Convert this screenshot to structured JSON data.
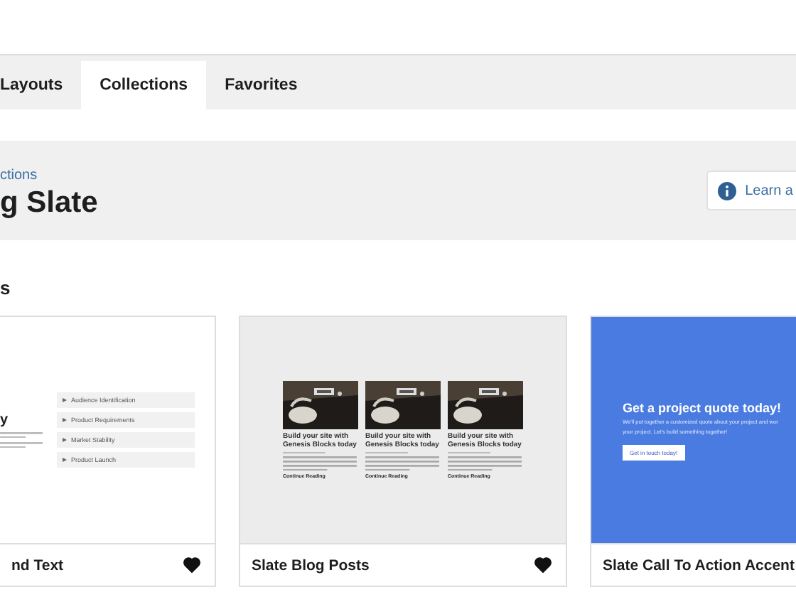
{
  "tabs": [
    {
      "label": "Layouts",
      "selected": false
    },
    {
      "label": "Collections",
      "selected": true
    },
    {
      "label": "Favorites",
      "selected": false
    }
  ],
  "header": {
    "breadcrumb": "ctions",
    "title": "g Slate",
    "learn_button": "Learn a"
  },
  "section_heading": "s",
  "cards": [
    {
      "kind": "list",
      "title": "nd Text",
      "favorited": true,
      "preview": {
        "heading": "y",
        "items": [
          "Audience Identification",
          "Product Requirements",
          "Market Stability",
          "Product Launch"
        ]
      }
    },
    {
      "kind": "posts",
      "title": "Slate Blog Posts",
      "favorited": true,
      "preview": {
        "posts": [
          {
            "title": "Build your site with Genesis Blocks today",
            "link": "Continue Reading"
          },
          {
            "title": "Build your site with Genesis Blocks today",
            "link": "Continue Reading"
          },
          {
            "title": "Build your site with Genesis Blocks today",
            "link": "Continue Reading"
          }
        ]
      }
    },
    {
      "kind": "cta",
      "title": "Slate Call To Action Accent",
      "preview": {
        "heading": "Get a project quote today!",
        "lines": [
          "We'll put together a customized quote about your project and wor",
          "your project. Let's build something together!"
        ],
        "button": "Get in touch today!"
      }
    }
  ]
}
